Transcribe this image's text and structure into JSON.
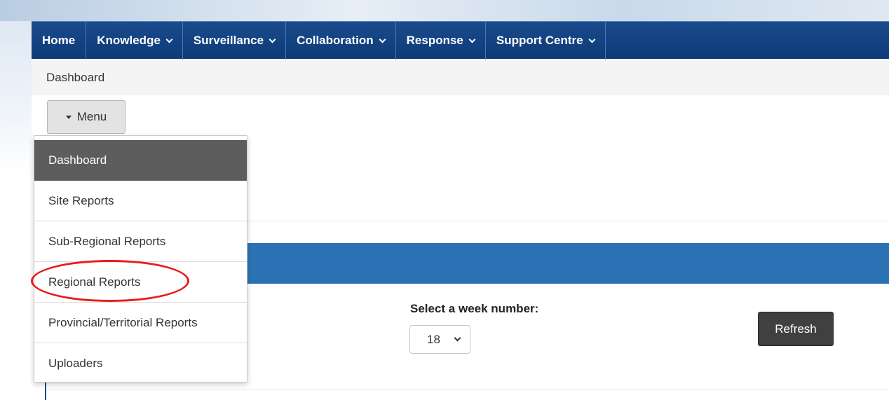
{
  "nav": {
    "items": [
      {
        "label": "Home",
        "has_dropdown": false
      },
      {
        "label": "Knowledge",
        "has_dropdown": true
      },
      {
        "label": "Surveillance",
        "has_dropdown": true
      },
      {
        "label": "Collaboration",
        "has_dropdown": true
      },
      {
        "label": "Response",
        "has_dropdown": true
      },
      {
        "label": "Support Centre",
        "has_dropdown": true
      }
    ]
  },
  "breadcrumb": "Dashboard",
  "menu_button": {
    "label": "Menu",
    "icon": "caret-down-icon"
  },
  "dropdown": {
    "items": [
      {
        "label": "Dashboard",
        "active": true
      },
      {
        "label": "Site Reports",
        "active": false
      },
      {
        "label": "Sub-Regional Reports",
        "active": false
      },
      {
        "label": "Regional Reports",
        "active": false,
        "annotated": true
      },
      {
        "label": "Provincial/Territorial Reports",
        "active": false
      },
      {
        "label": "Uploaders",
        "active": false
      }
    ]
  },
  "week_selector": {
    "label": "Select a week number:",
    "value": "18"
  },
  "refresh_button": {
    "label": "Refresh"
  },
  "colors": {
    "navbar": "#0e3a78",
    "blue_band": "#2b72b4",
    "active_menu": "#5d5d5d",
    "annotation": "#e81c1c"
  }
}
